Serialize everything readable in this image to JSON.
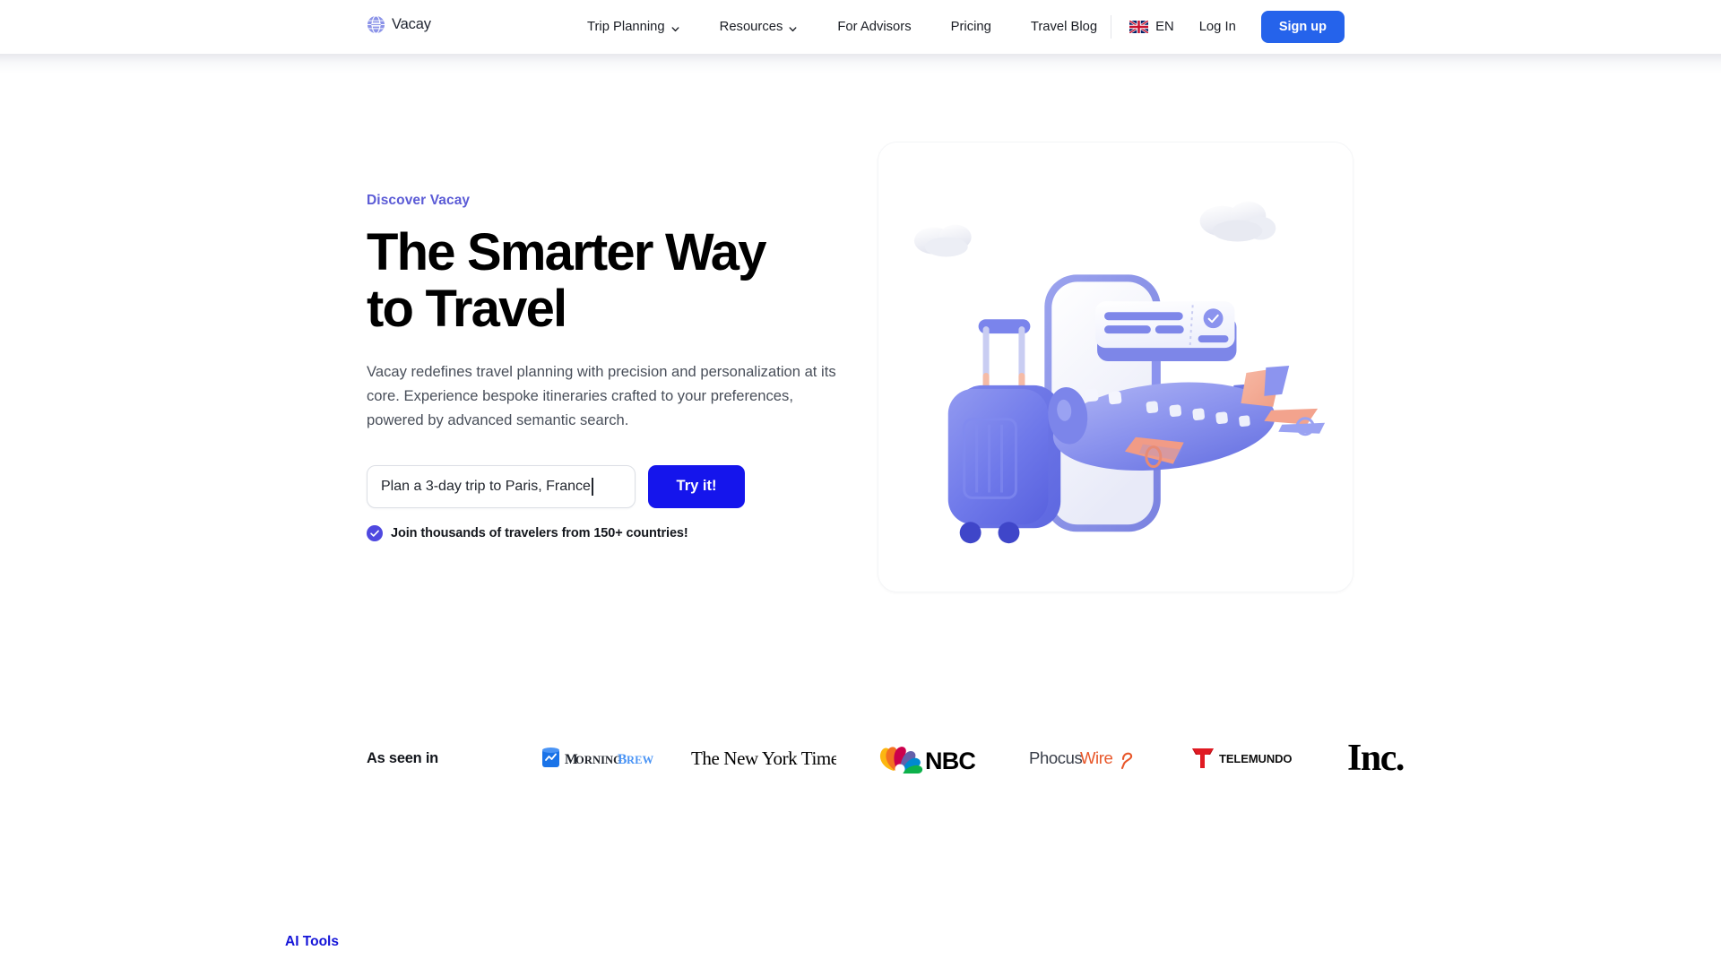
{
  "header": {
    "logo": {
      "text": "Vacay",
      "icon": "globe-icon"
    },
    "nav": [
      {
        "label": "Trip Planning",
        "has_dropdown": true
      },
      {
        "label": "Resources",
        "has_dropdown": true
      },
      {
        "label": "For Advisors",
        "has_dropdown": false
      },
      {
        "label": "Pricing",
        "has_dropdown": false
      },
      {
        "label": "Travel Blog",
        "has_dropdown": false
      }
    ],
    "language": {
      "code": "EN",
      "flag": "uk-flag-icon"
    },
    "login_label": "Log In",
    "signup_label": "Sign up"
  },
  "hero": {
    "eyebrow": "Discover Vacay",
    "headline": "The Smarter Way\nto Travel",
    "subcopy": "Vacay redefines travel planning with precision and personalization at its core. Experience bespoke itineraries crafted to your preferences, powered by advanced semantic search.",
    "search": {
      "value": "Plan a 3-day trip to Paris, France",
      "placeholder": "Plan a 3-day trip to Paris, France"
    },
    "cta_label": "Try it!",
    "trust_text": "Join thousands of travelers from 150+ countries!",
    "trust_icon": "check-circle-icon",
    "illustration": "travel-3d-illustration"
  },
  "press": {
    "label": "As seen in",
    "logos": [
      {
        "name": "Morning Brew"
      },
      {
        "name": "The New York Times"
      },
      {
        "name": "NBC"
      },
      {
        "name": "PhocusWire"
      },
      {
        "name": "Telemundo"
      },
      {
        "name": "Inc."
      }
    ]
  },
  "footer": {
    "ai_tools_label": "AI Tools"
  },
  "colors": {
    "brand_indigo": "#5b5bd6",
    "cta_blue": "#1515ec",
    "signup_blue": "#2563eb",
    "link_blue": "#1414d8",
    "headline": "#000000",
    "body_text": "#494f5a"
  }
}
